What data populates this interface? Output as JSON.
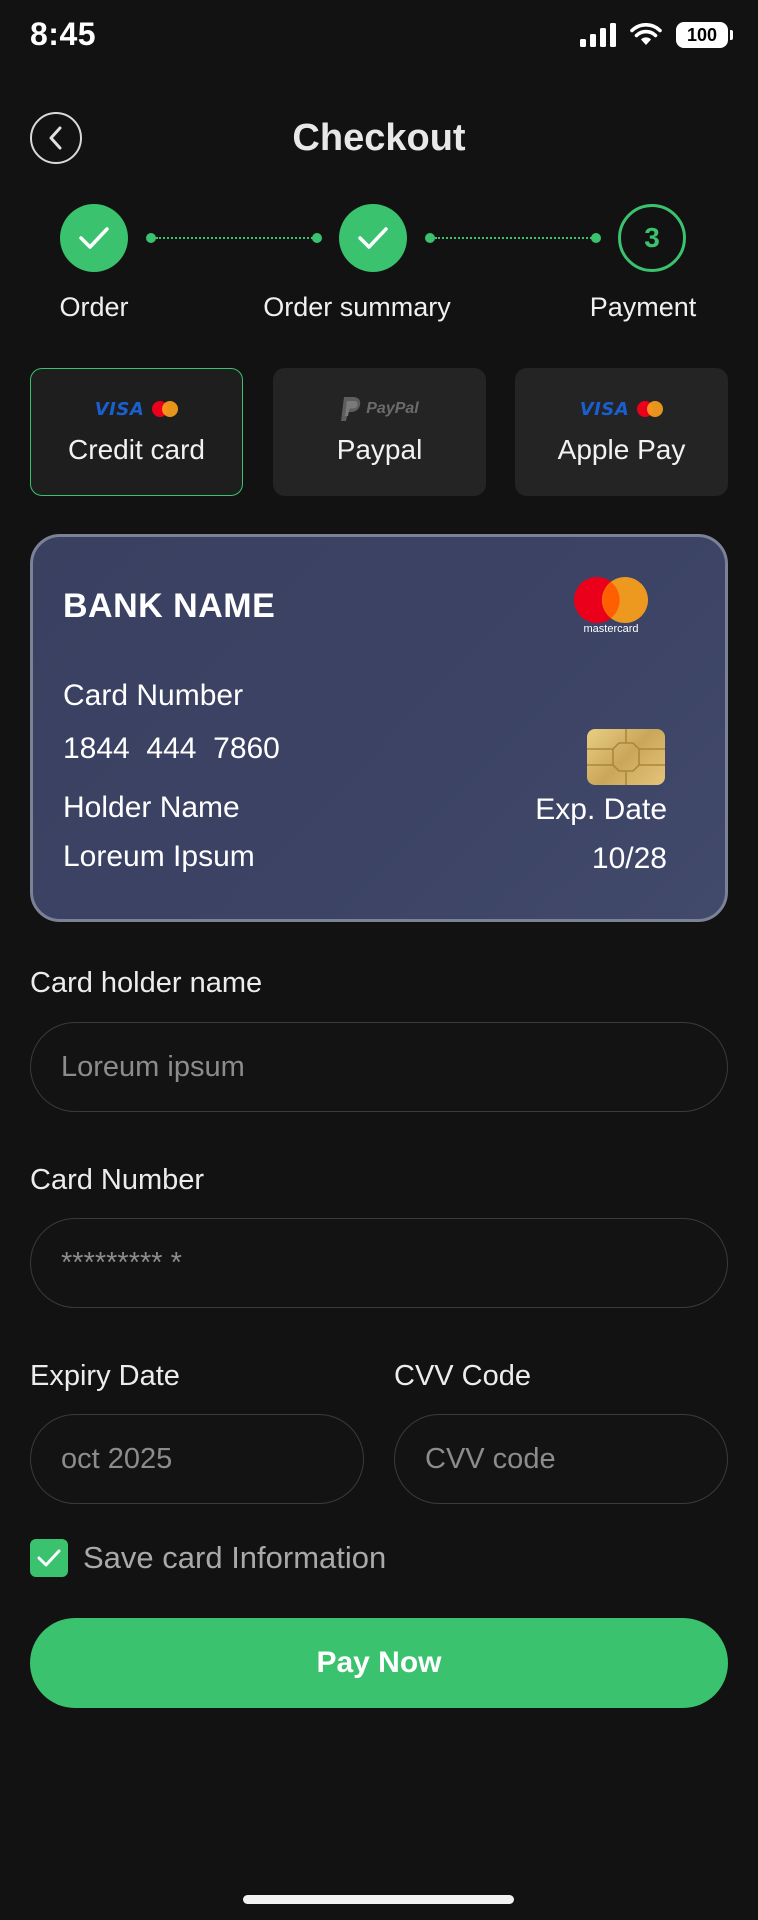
{
  "status_bar": {
    "time": "8:45",
    "battery": "100"
  },
  "header": {
    "title": "Checkout"
  },
  "stepper": {
    "steps": [
      {
        "label": "Order",
        "state": "done"
      },
      {
        "label": "Order summary",
        "state": "done"
      },
      {
        "label": "Payment",
        "state": "current",
        "number": "3"
      }
    ]
  },
  "payment_methods": [
    {
      "label": "Credit card",
      "active": true,
      "logos": [
        "VISA",
        "mastercard"
      ]
    },
    {
      "label": "Paypal",
      "active": false,
      "logos": [
        "PayPal"
      ]
    },
    {
      "label": "Apple Pay",
      "active": false,
      "logos": [
        "VISA",
        "mastercard"
      ]
    }
  ],
  "card": {
    "bank_name": "BANK NAME",
    "network": "mastercard",
    "number_label": "Card Number",
    "number": "1844  444  7860",
    "holder_label": "Holder Name",
    "holder": "Loreum Ipsum",
    "exp_label": "Exp. Date",
    "exp": "10/28"
  },
  "form": {
    "holder_label": "Card holder name",
    "holder_placeholder": "Loreum ipsum",
    "number_label": "Card Number",
    "number_placeholder": "********* *",
    "expiry_label": "Expiry Date",
    "expiry_placeholder": "oct 2025",
    "cvv_label": "CVV Code",
    "cvv_placeholder": "CVV code",
    "save_label": "Save card Information",
    "save_checked": true
  },
  "actions": {
    "pay_label": "Pay Now"
  },
  "colors": {
    "accent": "#3ac26e",
    "background": "#121212",
    "card": "#3c4365"
  }
}
